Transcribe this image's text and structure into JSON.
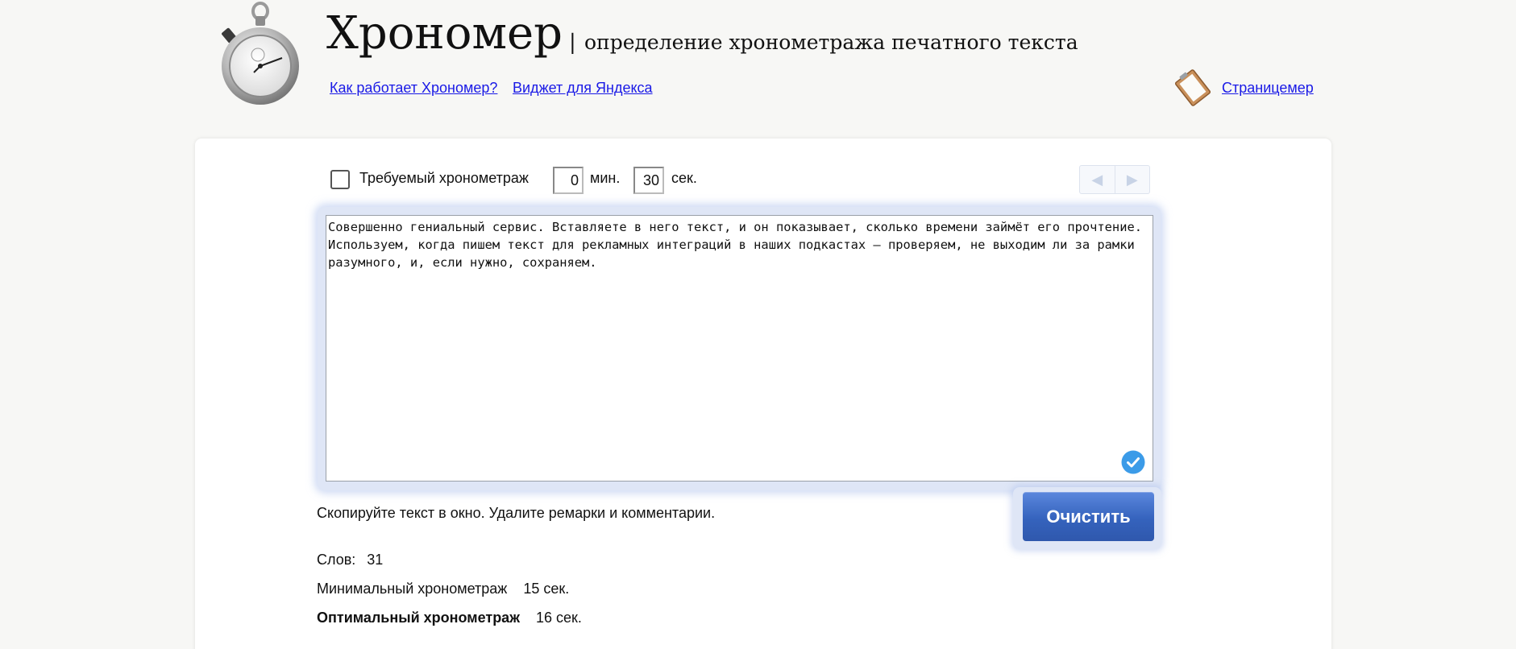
{
  "header": {
    "title": "Хрономер",
    "separator": "|",
    "subtitle": "определение хронометража печатного текста",
    "links": {
      "how_it_works": "Как работает Хрономер?",
      "yandex_widget": "Виджет для Яндекса",
      "page_meter": "Страницемер"
    },
    "icons": {
      "logo": "stopwatch-icon",
      "page_meter": "clipboard-icon"
    }
  },
  "controls": {
    "required_duration_label": "Требуемый хронометраж",
    "required_checked": false,
    "minutes_value": "0",
    "minutes_label": "мин.",
    "seconds_value": "30",
    "seconds_label": "сек.",
    "prev_icon": "arrow-left-icon",
    "next_icon": "arrow-right-icon",
    "prev_glyph": "◀",
    "next_glyph": "▶"
  },
  "editor": {
    "text": "Совершенно гениальный сервис. Вставляете в него текст, и он показывает, сколько времени займёт его прочтение. Используем, когда пишем текст для рекламных интеграций в наших подкастах — проверяем, не выходим ли за рамки разумного, и, если нужно, сохраняем.",
    "status_icon": "check-circle-icon"
  },
  "hint": "Скопируйте текст в окно. Удалите ремарки и комментарии.",
  "clear_label": "Очистить",
  "stats": {
    "words_label": "Слов:",
    "words_value": "31",
    "min_label": "Минимальный хронометраж",
    "min_value": "15 сек.",
    "opt_label": "Оптимальный хронометраж",
    "opt_value": "16 сек."
  },
  "colors": {
    "link": "#1a1ae6",
    "accent": "#3563bd",
    "check": "#3b9be8",
    "background": "#f7f7f5"
  }
}
